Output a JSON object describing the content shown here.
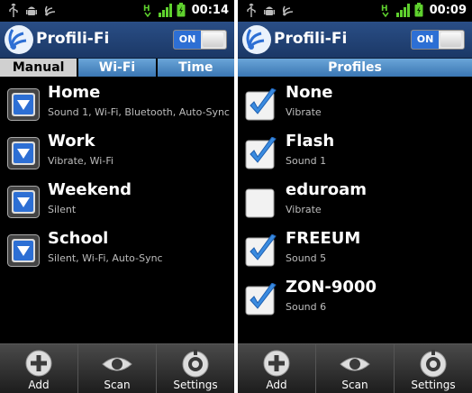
{
  "status": {
    "left_time": "00:14",
    "right_time": "00:09"
  },
  "app": {
    "title": "Profili-Fi",
    "toggle_label": "ON"
  },
  "left": {
    "tabs": [
      {
        "label": "Manual"
      },
      {
        "label": "Wi-Fi"
      },
      {
        "label": "Time"
      }
    ],
    "profiles": [
      {
        "title": "Home",
        "subtitle": "Sound 1, Wi-Fi, Bluetooth, Auto-Sync"
      },
      {
        "title": "Work",
        "subtitle": "Vibrate, Wi-Fi"
      },
      {
        "title": "Weekend",
        "subtitle": "Silent"
      },
      {
        "title": "School",
        "subtitle": "Silent, Wi-Fi, Auto-Sync"
      }
    ]
  },
  "right": {
    "header": "Profiles",
    "profiles": [
      {
        "title": "None",
        "subtitle": "Vibrate",
        "checked": true
      },
      {
        "title": "Flash",
        "subtitle": "Sound 1",
        "checked": true
      },
      {
        "title": "eduroam",
        "subtitle": "Vibrate",
        "checked": false
      },
      {
        "title": "FREEUM",
        "subtitle": "Sound 5",
        "checked": true
      },
      {
        "title": "ZON-9000",
        "subtitle": "Sound 6",
        "checked": true
      }
    ]
  },
  "bottom": [
    {
      "label": "Add"
    },
    {
      "label": "Scan"
    },
    {
      "label": "Settings"
    }
  ],
  "colors": {
    "accent": "#2d6fd4",
    "appbar": "#1b3866",
    "tab": "#4a88c4",
    "check": "#3a8be0"
  }
}
